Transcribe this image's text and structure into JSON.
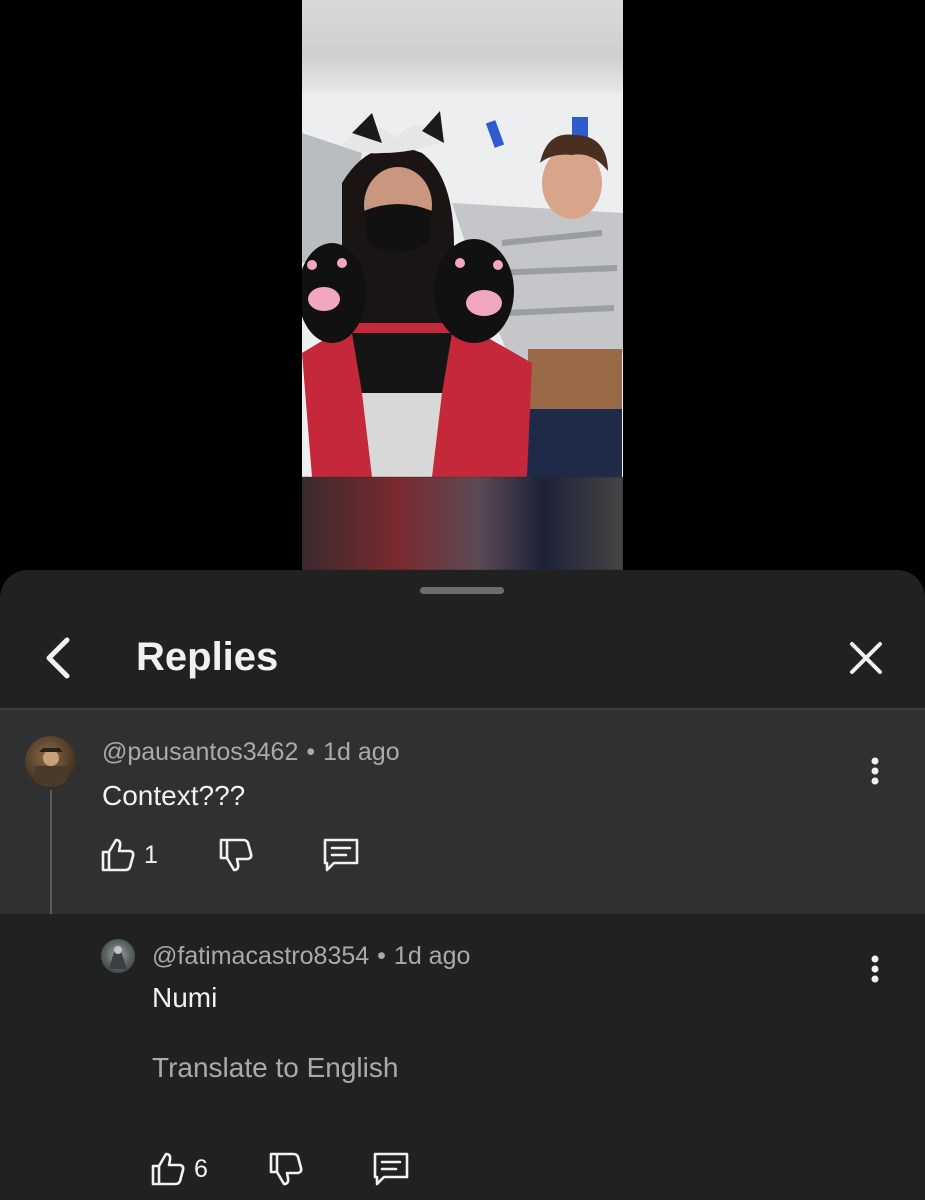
{
  "sheet": {
    "title": "Replies"
  },
  "parent_comment": {
    "author": "@pausantos3462",
    "time": "1d ago",
    "text": "Context???",
    "likes": "1"
  },
  "reply": {
    "author": "@fatimacastro8354",
    "time": "1d ago",
    "text": "Numi",
    "translate_label": "Translate to English",
    "likes": "6"
  },
  "icons": {
    "back": "chevron-left-icon",
    "close": "close-icon",
    "more": "more-vertical-icon",
    "like": "thumbs-up-icon",
    "dislike": "thumbs-down-icon",
    "reply": "comment-icon"
  },
  "colors": {
    "sheet_bg": "#212121",
    "highlight_bg": "#303030",
    "text_primary": "#f1f1f1",
    "text_secondary": "#aaaaaa"
  }
}
